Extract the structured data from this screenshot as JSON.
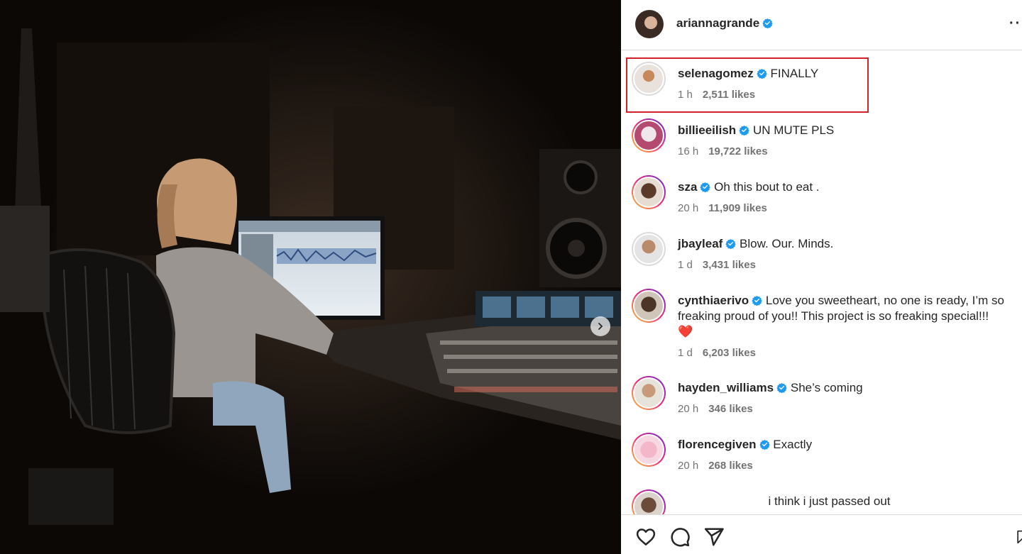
{
  "post": {
    "author": "ariannagrande",
    "verified": true,
    "more_label": "···"
  },
  "comments": [
    {
      "user": "selenagomez",
      "text": "FINALLY",
      "time": "1 h",
      "likes": "2,511 likes",
      "highlighted": true
    },
    {
      "user": "billieeilish",
      "text": "UN MUTE PLS",
      "time": "16 h",
      "likes": "19,722 likes"
    },
    {
      "user": "sza",
      "text": "Oh this bout to eat .",
      "time": "20 h",
      "likes": "11,909 likes"
    },
    {
      "user": "jbayleaf",
      "text": "Blow. Our. Minds.",
      "time": "1 d",
      "likes": "3,431 likes"
    },
    {
      "user": "cynthiaerivo",
      "text": "Love you sweetheart, no one is ready, I’m so freaking proud of you!! This project is so freaking special!!!",
      "emoji": "❤️",
      "time": "1 d",
      "likes": "6,203 likes"
    },
    {
      "user": "hayden_williams",
      "text": "She’s coming",
      "time": "20 h",
      "likes": "346 likes"
    },
    {
      "user": "florencegiven",
      "text": "Exactly",
      "time": "20 h",
      "likes": "268 likes"
    },
    {
      "user": "",
      "text": "i think i just passed out",
      "time": "",
      "likes": ""
    }
  ],
  "colors": {
    "verified_badge": "#1d9bf0",
    "highlight_border": "#d2232a",
    "meta_text": "#737373"
  },
  "icons": {
    "like": "heart-icon",
    "comment": "comment-icon",
    "share": "send-icon",
    "save": "bookmark-icon",
    "next": "chevron-right-icon",
    "verified": "verified-badge-icon"
  }
}
